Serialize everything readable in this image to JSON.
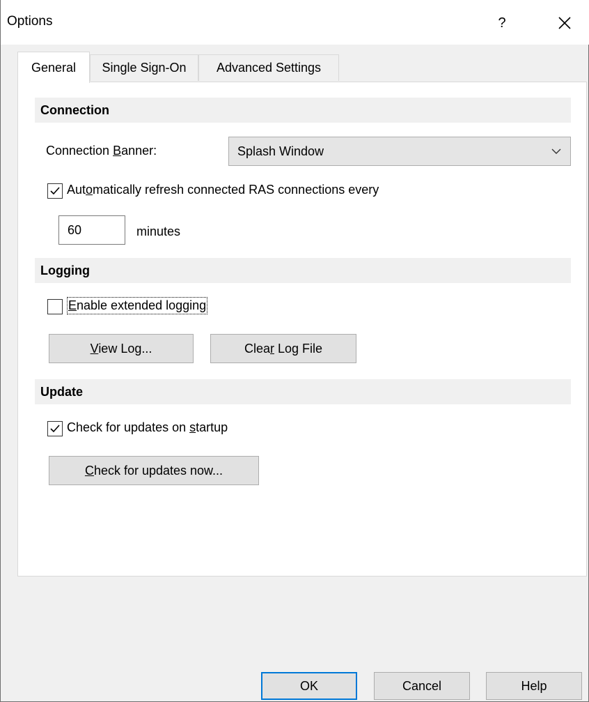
{
  "window": {
    "title": "Options",
    "help_label": "?"
  },
  "tabs": [
    {
      "label": "General"
    },
    {
      "label": "Single Sign-On"
    },
    {
      "label": "Advanced Settings"
    }
  ],
  "connection": {
    "header": "Connection",
    "banner_label_pre": "Connection ",
    "banner_label_key": "B",
    "banner_label_post": "anner:",
    "banner_value": "Splash Window",
    "auto_refresh_checked": true,
    "auto_refresh_pre": "Aut",
    "auto_refresh_key": "o",
    "auto_refresh_post": "matically refresh connected RAS connections every",
    "minutes_value": "60",
    "minutes_label": "minutes"
  },
  "logging": {
    "header": "Logging",
    "extended_checked": false,
    "extended_key": "E",
    "extended_post": "nable extended logging",
    "view_log_key": "V",
    "view_log_post": "iew Log...",
    "clear_log_pre": "Clea",
    "clear_log_key": "r",
    "clear_log_post": " Log File"
  },
  "update": {
    "header": "Update",
    "startup_checked": true,
    "startup_pre": "Check for updates on ",
    "startup_key": "s",
    "startup_post": "tartup",
    "check_now_key": "C",
    "check_now_post": "heck for updates now..."
  },
  "footer": {
    "ok": "OK",
    "cancel": "Cancel",
    "help": "Help"
  },
  "colors": {
    "accent": "#0078d7",
    "section_bg": "#f0f0f0"
  }
}
